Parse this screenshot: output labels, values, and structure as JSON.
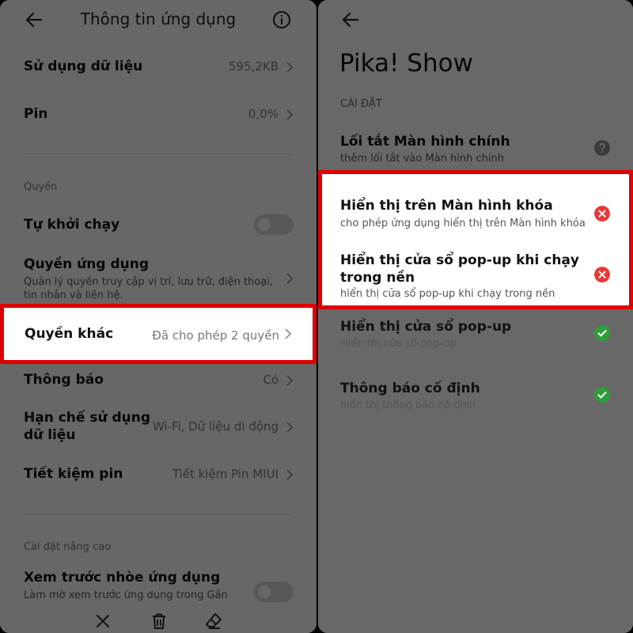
{
  "left": {
    "title": "Thông tin ứng dụng",
    "data_usage": {
      "label": "Sử dụng dữ liệu",
      "value": "595,2KB"
    },
    "battery": {
      "label": "Pin",
      "value": "0,0%"
    },
    "permissions_section": "Quyền",
    "autostart": {
      "label": "Tự khởi chạy"
    },
    "app_permissions": {
      "label": "Quyền ứng dụng",
      "sub": "Quản lý quyền truy cập vị trí, lưu trữ, điện thoại, tin nhắn và liên hệ."
    },
    "other_permissions": {
      "label": "Quyền khác",
      "value": "Đã cho phép 2 quyền"
    },
    "notifications": {
      "label": "Thông báo",
      "value": "Có"
    },
    "restrict_data": {
      "label": "Hạn chế sử dụng dữ liệu",
      "value": "Wi-Fi, Dữ liệu di động"
    },
    "battery_saver": {
      "label": "Tiết kiệm pin",
      "value": "Tiết kiệm Pin MIUI"
    },
    "advanced_section": "Cài đặt nâng cao",
    "blur_preview": {
      "label": "Xem trước nhòe ứng dụng",
      "sub": "Làm mờ xem trước ứng dụng trong Gần"
    }
  },
  "right": {
    "app_name": "Pika! Show",
    "section": "CÀI ĐẶT",
    "items": [
      {
        "title": "Lối tắt Màn hình chính",
        "sub": "thêm lối tắt vào Màn hình chính",
        "status": "unknown"
      },
      {
        "title": "Hiển thị trên Màn hình khóa",
        "sub": "cho phép ứng dụng hiển thị trên Màn hình khóa",
        "status": "denied"
      },
      {
        "title": "Hiển thị cửa sổ pop-up khi chạy trong nền",
        "sub": "hiển thị cửa sổ pop-up khi chạy trong nền",
        "status": "denied"
      },
      {
        "title": "Hiển thị cửa sổ pop-up",
        "sub": "Hiển thị cửa sổ pop-up",
        "status": "allowed"
      },
      {
        "title": "Thông báo cố định",
        "sub": "hiển thị thông báo cố định",
        "status": "allowed"
      }
    ]
  },
  "colors": {
    "highlight": "#e00000",
    "allowed": "#2e9e3a",
    "denied": "#e53935",
    "unknown": "#8a8a8a"
  }
}
